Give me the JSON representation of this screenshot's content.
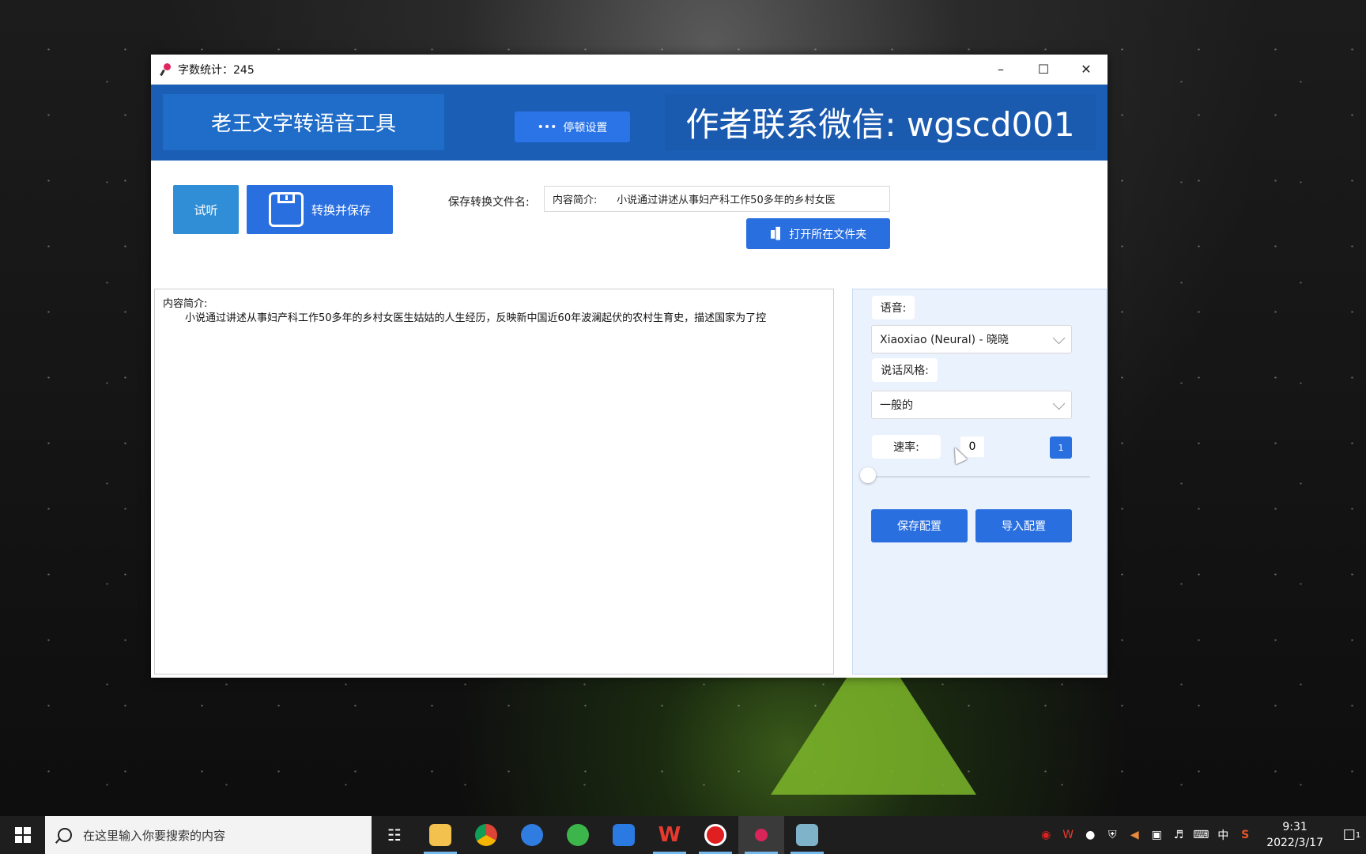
{
  "window": {
    "title": "字数统计：245"
  },
  "header": {
    "app_title": "老王文字转语音工具",
    "pause_button": "停顿设置",
    "author": "作者联系微信: wgscd001"
  },
  "toolbar": {
    "listen": "试听",
    "convert_save": "转换并保存",
    "save_filename_label": "保存转换文件名:",
    "filename_value": "内容简介:      小说通过讲述从事妇产科工作50多年的乡村女医",
    "open_folder": "打开所在文件夹"
  },
  "editor": {
    "line1": "内容简介:",
    "line2": "小说通过讲述从事妇产科工作50多年的乡村女医生姑姑的人生经历，反映新中国近60年波澜起伏的农村生育史，描述国家为了控"
  },
  "panel": {
    "voice_label": "语音:",
    "voice_value": "Xiaoxiao (Neural) - 晓晓",
    "style_label": "说话风格:",
    "style_value": "一般的",
    "rate_label": "速率:",
    "rate_value": "0",
    "rate_button": "1",
    "save_config": "保存配置",
    "import_config": "导入配置"
  },
  "taskbar": {
    "search_placeholder": "在这里输入你要搜索的内容",
    "ime": "中",
    "time": "9:31",
    "date": "2022/3/17",
    "notification_count": "1",
    "icons": [
      "task-view-icon",
      "file-explorer-icon",
      "chrome-icon",
      "browser-bird-icon",
      "browser-e-icon",
      "feishu-icon",
      "wps-icon",
      "record-icon",
      "tts-app-icon",
      "notebook-icon"
    ]
  }
}
